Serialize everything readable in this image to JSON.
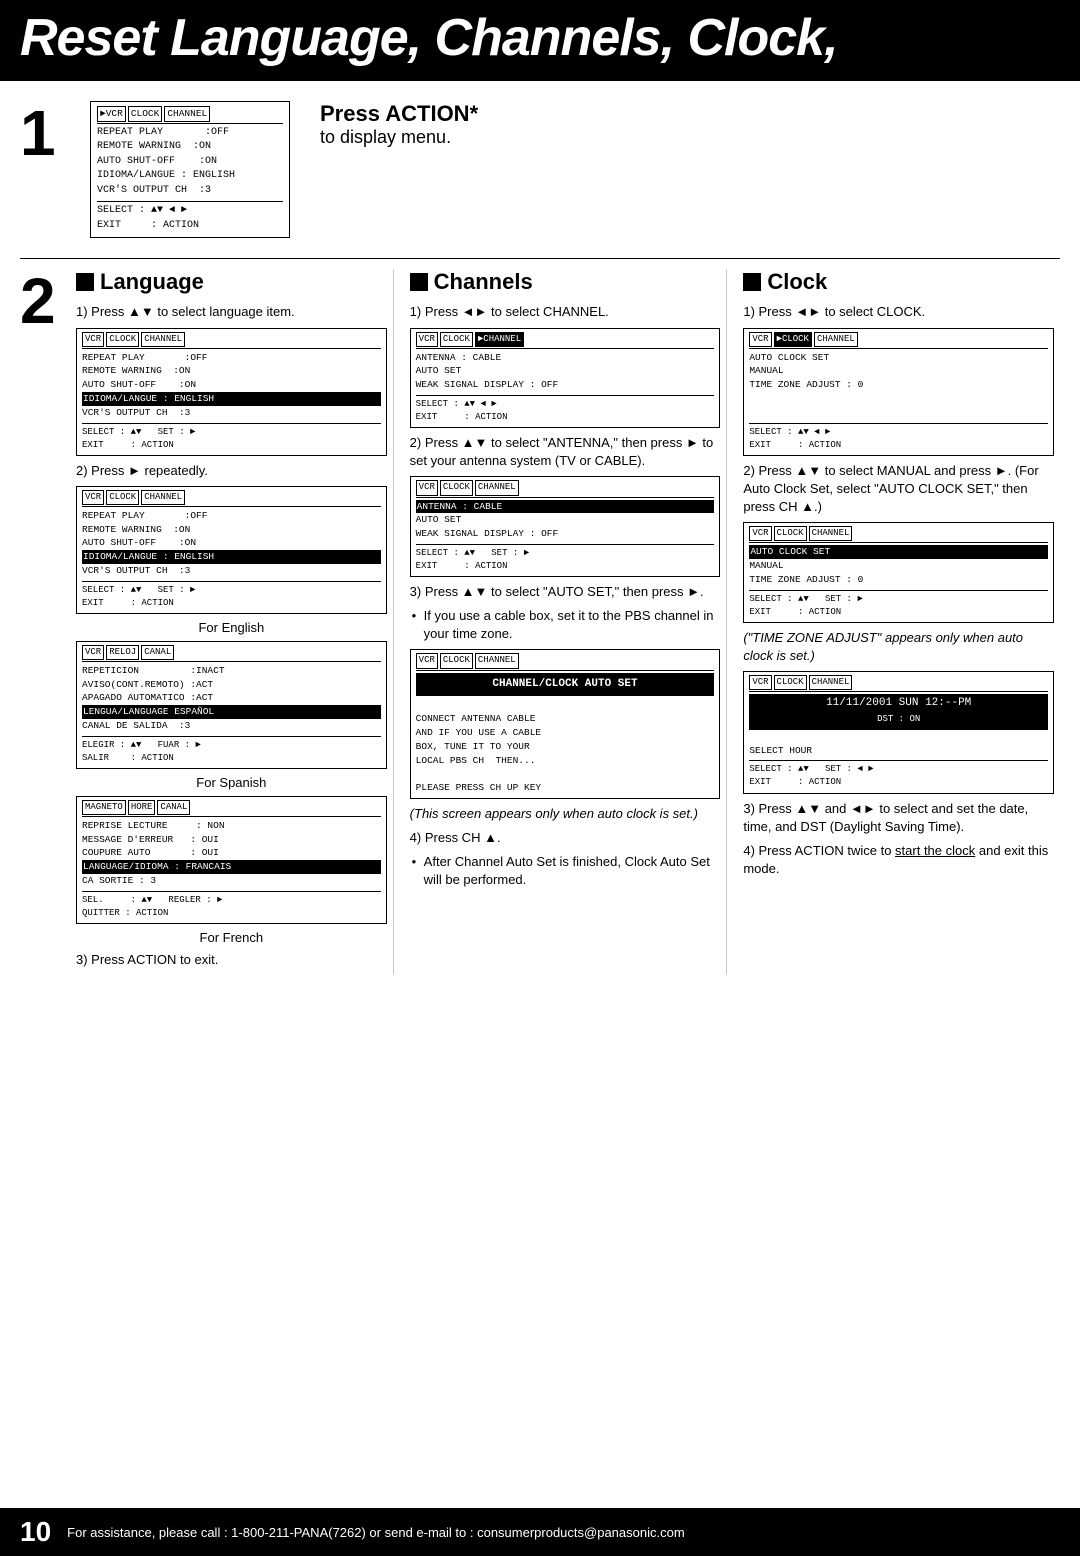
{
  "header": {
    "title": "Reset Language, Channels, Clock,"
  },
  "step1": {
    "number": "1",
    "screen": {
      "header": [
        "►VCR",
        "CLOCK",
        "CHANNEL"
      ],
      "lines": [
        "REPEAT PLAY       :OFF",
        "REMOTE WARNING  :ON",
        "AUTO SHUT-OFF     :ON",
        "IDIOMA/LANGUE : ENGLISH",
        "VCR'S OUTPUT CH  :3"
      ],
      "footer": [
        "SELECT : ▲▼ ◄ ►",
        "EXIT      : ACTION"
      ]
    },
    "instruction1": "Press ACTION*",
    "instruction2": "to display menu."
  },
  "step2": {
    "number": "2",
    "language": {
      "title": "Language",
      "steps": [
        {
          "desc": "1) Press ▲▼ to select language item.",
          "screen": {
            "header": [
              "VCR",
              "CLOCK",
              "CHANNEL"
            ],
            "lines": [
              "REPEAT PLAY       :OFF",
              "REMOTE WARNING  :ON",
              "AUTO SHUT-OFF     :ON",
              "IDIOMA/LANGUE : ENGLISH",
              "VCR'S OUTPUT CH  :3"
            ],
            "footer_lines": [
              "SELECT : ▲▼    SET : ►",
              "EXIT      : ACTION"
            ]
          }
        },
        {
          "desc": "2) Press ► repeatedly.",
          "screen": {
            "header": [
              "VCR",
              "CLOCK",
              "CHANNEL"
            ],
            "lines": [
              "REPEAT PLAY       :OFF",
              "REMOTE WARNING  :ON",
              "AUTO SHUT-OFF     :ON",
              "IDIOMA/LANGUE : ENGLISH",
              "VCR'S OUTPUT CH  :3"
            ],
            "footer_lines": [
              "SELECT : ▲▼    SET : ►",
              "EXIT      : ACTION"
            ]
          }
        },
        {
          "caption": "For English",
          "screen_spanish": {
            "header": [
              "VCR",
              "RELOJ",
              "CANAL"
            ],
            "lines": [
              "REPETICION            :INACT",
              "AVISO(CONT.REMOTO) :ACT",
              "APAGADO AUTOMATICO :ACT",
              "LENGUA/LANGUAGE ESPAÑOL",
              "CANAL DE SALIDA  :3"
            ],
            "footer_lines": [
              "ELEGIR : ▲▼    FUAR : ►",
              "SALIR    : ACTION"
            ]
          },
          "caption_spanish": "For Spanish",
          "screen_french": {
            "header": [
              "MAGNETO",
              "HORE",
              "CANAL"
            ],
            "lines": [
              "REPRISE LECTURE        : NON",
              "MESSAGE D'ERREUR    : OUI",
              "COUPURE AUTO           : OUI",
              "LANGUAGE/IDIOMA : FRANCAIS",
              "CA SORTIE : 3"
            ],
            "footer_lines": [
              "SEL.      : ▲▼    REGLER : ►",
              "QUITTER : ACTION"
            ]
          },
          "caption_french": "For French"
        }
      ],
      "step3": "3) Press ACTION to exit."
    },
    "channels": {
      "title": "Channels",
      "steps": [
        {
          "desc": "1) Press ◄► to select CHANNEL.",
          "screen": {
            "header": [
              "VCR",
              "CLOCK",
              "►CHANNEL"
            ],
            "lines": [
              "ANTENNA : CABLE",
              "AUTO SET",
              "WEAK SIGNAL DISPLAY : OFF"
            ],
            "footer_lines": [
              "SELECT : ▲▼ ◄ ►",
              "EXIT      : ACTION"
            ]
          }
        },
        {
          "desc": "2) Press ▲▼ to select \"ANTENNA,\" then press ► to set your antenna system (TV or CABLE).",
          "screen": {
            "header": [
              "VCR",
              "CLOCK",
              "CHANNEL"
            ],
            "highlight": "ANTENNA : CABLE",
            "lines": [
              "AUTO SET",
              "WEAK SIGNAL DISPLAY : OFF"
            ],
            "footer_lines": [
              "SELECT : ▲▼    SET : ►",
              "EXIT      : ACTION"
            ]
          }
        },
        {
          "desc": "3) Press ▲▼ to select \"AUTO SET,\" then press ►.",
          "bullet": "If you use a cable box, set it to the PBS channel in your time zone.",
          "screen": {
            "header": [
              "VCR",
              "CLOCK",
              "CHANNEL"
            ],
            "highlight": "CHANNEL/CLOCK AUTO SET",
            "lines": [
              "CONNECT ANTENNA CABLE",
              "AND IF YOU USE A CABLE",
              "BOX, TUNE IT TO YOUR",
              "LOCAL PBS CH  THEN...",
              "",
              "PLEASE PRESS CH UP KEY"
            ],
            "footer_lines": []
          },
          "screen_note": "(This screen appears only when auto clock is set.)"
        },
        {
          "desc": "4) Press CH ▲.",
          "bullet": "After Channel Auto Set is finished, Clock Auto Set will be performed."
        }
      ]
    },
    "clock": {
      "title": "Clock",
      "steps": [
        {
          "desc": "1) Press ◄► to select CLOCK.",
          "screen": {
            "header": [
              "VCR",
              "►CLOCK",
              "CHANNEL"
            ],
            "lines": [
              "AUTO CLOCK SET",
              "MANUAL",
              "TIME ZONE ADJUST : 0"
            ],
            "footer_lines": [
              "SELECT : ▲▼ ◄ ►",
              "EXIT      : ACTION"
            ]
          }
        },
        {
          "desc": "2) Press ▲▼ to select MANUAL and press ►. (For Auto Clock Set, select \"AUTO CLOCK SET,\" then press CH ▲.)",
          "screen1": {
            "header": [
              "VCR",
              "CLOCK",
              "CHANNEL"
            ],
            "highlight": "AUTO CLOCK SET",
            "lines": [
              "MANUAL",
              "TIME ZONE ADJUST : 0"
            ],
            "footer_lines": [
              "SELECT : ▲▼    SET : ►",
              "EXIT      : ACTION"
            ]
          },
          "note": "(\"TIME ZONE ADJUST\" appears only when auto clock is set.)",
          "screen2": {
            "header": [
              "VCR",
              "CLOCK",
              "CHANNEL"
            ],
            "highlight": "11/11/2001 SUN 12:--PM",
            "dst": "DST : ON",
            "lines": [
              "SELECT HOUR"
            ],
            "footer_lines": [
              "SELECT : ▲▼    SET : ◄ ►",
              "EXIT      : ACTION"
            ]
          }
        },
        {
          "desc": "3) Press ▲▼ and ◄► to select and set the date, time, and DST (Daylight Saving Time)."
        },
        {
          "desc": "4) Press ACTION twice to start the clock and exit this mode.",
          "underline": "start the clock"
        }
      ]
    }
  },
  "footer": {
    "page_number": "10",
    "text": "For assistance, please call : 1-800-211-PANA(7262) or send e-mail to : consumerproducts@panasonic.com"
  }
}
